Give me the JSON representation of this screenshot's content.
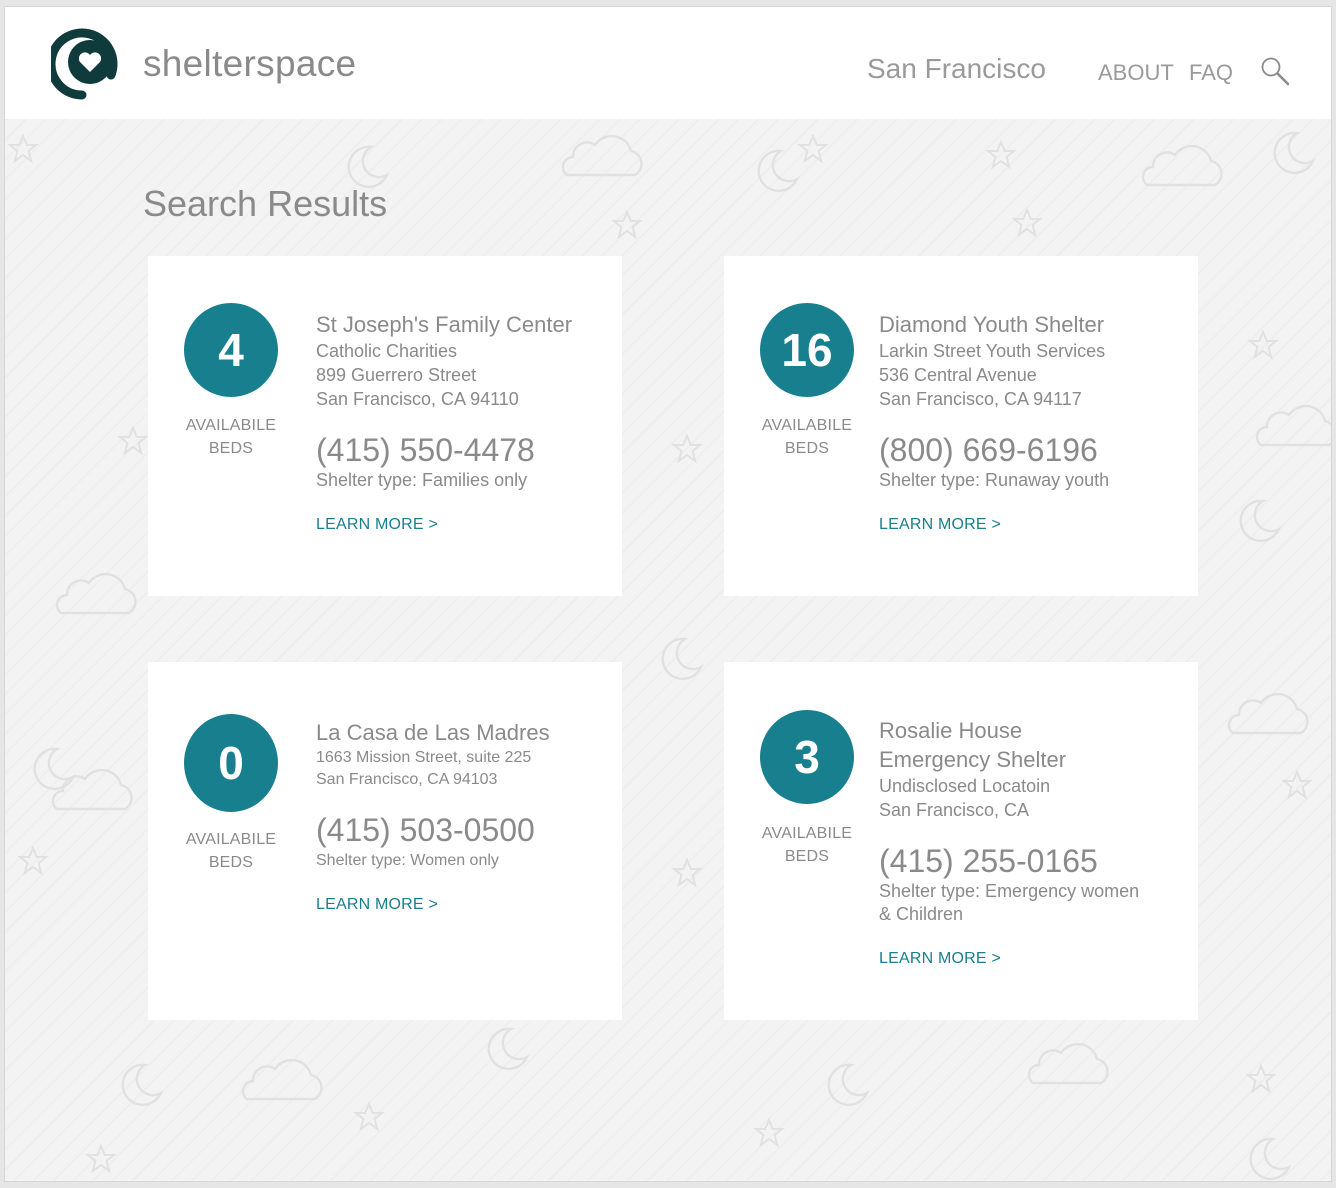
{
  "header": {
    "brand": "shelterspace",
    "city": "San Francisco",
    "nav": {
      "about": "ABOUT",
      "faq": "FAQ"
    },
    "search_icon": "magnifier-icon",
    "logo_icon": "heart-location-icon"
  },
  "main": {
    "title": "Search Results"
  },
  "colors": {
    "accent": "#177f8e",
    "logo": "#0f3b3c",
    "text": "#8a8a8a",
    "background": "#f4f3f3"
  },
  "shelters": [
    {
      "beds": "4",
      "beds_caption": [
        "AVAILABILE",
        "BEDS"
      ],
      "name": "St Joseph's Family Center",
      "org": "Catholic Charities",
      "address": "899 Guerrero Street",
      "city": "San Francisco, CA 94110",
      "phone": "(415) 550-4478",
      "type": "Shelter type: Families only",
      "learn_more": "LEARN MORE >"
    },
    {
      "beds": "16",
      "beds_caption": [
        "AVAILABILE",
        "BEDS"
      ],
      "name": "Diamond Youth Shelter",
      "org": "Larkin Street Youth Services",
      "address": "536 Central Avenue",
      "city": "San Francisco, CA 94117",
      "phone": "(800) 669-6196",
      "type": "Shelter type:  Runaway youth",
      "learn_more": "LEARN MORE >"
    },
    {
      "beds": "0",
      "beds_caption": [
        "AVAILABILE",
        "BEDS"
      ],
      "name": "La Casa de Las Madres",
      "address": "1663 Mission Street, suite 225",
      "city": "San Francisco, CA 94103",
      "phone": "(415) 503-0500",
      "type": "Shelter type: Women only",
      "learn_more": "LEARN MORE >"
    },
    {
      "beds": "3",
      "beds_caption": [
        "AVAILABILE",
        "BEDS"
      ],
      "name": [
        "Rosalie House",
        "Emergency Shelter"
      ],
      "address": "Undisclosed Locatoin",
      "city": "San Francisco, CA",
      "phone": "(415) 255-0165",
      "type": [
        "Shelter type:  Emergency women",
        "& Children"
      ],
      "learn_more": "LEARN MORE >"
    }
  ]
}
